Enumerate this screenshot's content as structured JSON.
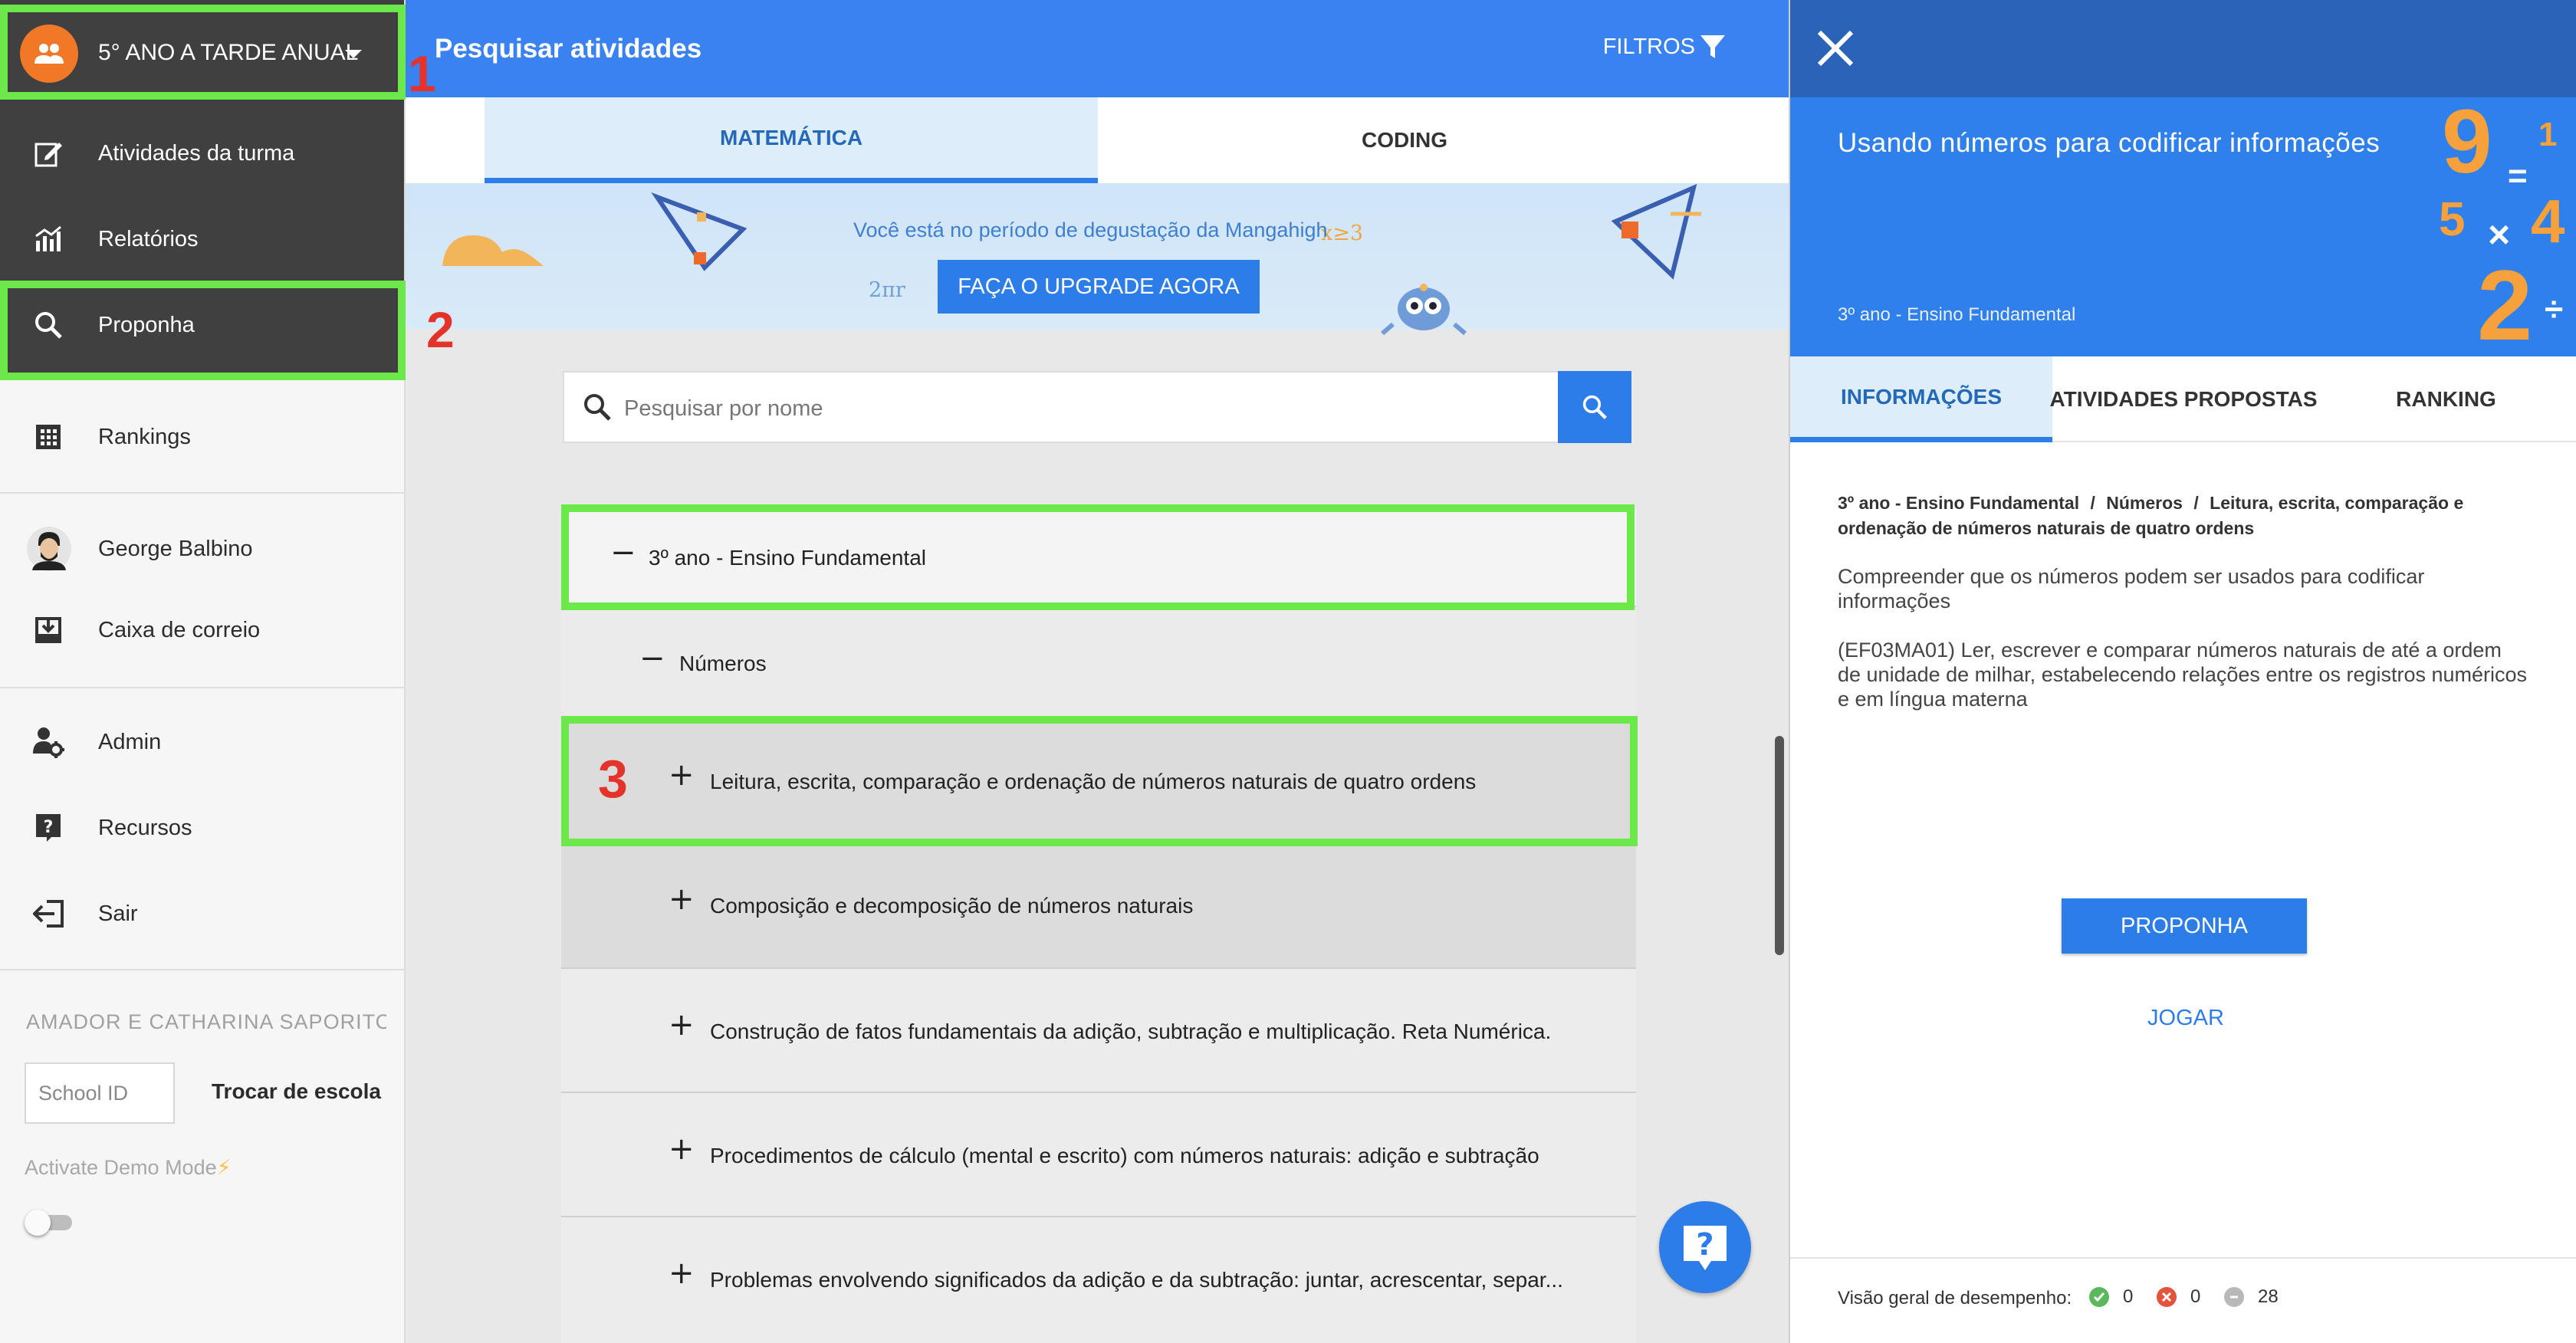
{
  "sidebar": {
    "class_selector": {
      "label": "5° ANO A TARDE ANUAL"
    },
    "items": [
      {
        "label": "Atividades da turma",
        "icon": "edit-icon"
      },
      {
        "label": "Relatórios",
        "icon": "bar-chart-icon"
      },
      {
        "label": "Proponha",
        "icon": "search-icon"
      },
      {
        "label": "Rankings",
        "icon": "grid-icon"
      },
      {
        "label": "George Balbino",
        "icon": "user-avatar"
      },
      {
        "label": "Caixa de correio",
        "icon": "inbox-icon"
      },
      {
        "label": "Admin",
        "icon": "admin-gear-icon"
      },
      {
        "label": "Recursos",
        "icon": "help-book-icon"
      },
      {
        "label": "Sair",
        "icon": "logout-icon"
      }
    ],
    "school_name": "AMADOR E CATHARINA SAPORITO ...",
    "school_id_placeholder": "School ID",
    "switch_school": "Trocar de escola",
    "demo_mode": "Activate Demo Mode",
    "demo_mode_on": false
  },
  "main": {
    "title": "Pesquisar atividades",
    "filters_label": "FILTROS",
    "tabs": [
      {
        "label": "MATEMÁTICA",
        "active": true
      },
      {
        "label": "CODING",
        "active": false
      }
    ],
    "banner": {
      "text": "Você está no período de degustação da Mangahigh",
      "button": "FAÇA O UPGRADE AGORA",
      "math_1": "2πr",
      "math_2": "x≥3"
    },
    "search": {
      "placeholder": "Pesquisar por nome"
    },
    "tree": [
      {
        "sign": "−",
        "label": "3º ano - Ensino Fundamental",
        "level": 0
      },
      {
        "sign": "−",
        "label": "Números",
        "level": 1
      },
      {
        "sign": "+",
        "label": "Leitura, escrita, comparação e ordenação de números naturais de quatro ordens",
        "level": 2
      },
      {
        "sign": "+",
        "label": "Composição e decomposição de números naturais",
        "level": 2
      },
      {
        "sign": "+",
        "label": "Construção de fatos fundamentais da adição, subtração e multiplicação. Reta Numérica.",
        "level": 2
      },
      {
        "sign": "+",
        "label": "Procedimentos de cálculo (mental e escrito) com números naturais: adição e subtração",
        "level": 2
      },
      {
        "sign": "+",
        "label": "Problemas envolvendo significados da adição e da subtração: juntar, acrescentar, separ...",
        "level": 2
      }
    ]
  },
  "annotations": {
    "step1": "1",
    "step2": "2",
    "step3": "3",
    "highlight_color": "#6de84a",
    "number_color": "#e4332b"
  },
  "panel": {
    "title": "Usando números para codificar informações",
    "grade": "3º ano - Ensino Fundamental",
    "deco": {
      "d1": "9",
      "d2": "1",
      "d3": "=",
      "d4": "5",
      "d5": "4",
      "d6": "×",
      "d7": "2",
      "d8": "÷"
    },
    "tabs": [
      {
        "label": "INFORMAÇÕES",
        "active": true
      },
      {
        "label": "ATIVIDADES PROPOSTAS",
        "active": false
      },
      {
        "label": "RANKING",
        "active": false
      }
    ],
    "breadcrumb": {
      "part1": "3º ano - Ensino Fundamental",
      "sep": "/",
      "part2": "Números",
      "part3": "Leitura, escrita, comparação e ordenação de números naturais de quatro ordens"
    },
    "description": "Compreender que os números podem ser usados para codificar informações",
    "standard": "(EF03MA01) Ler, escrever e comparar números naturais de até a ordem de unidade de milhar, estabelecendo relações entre os registros numéricos e em língua materna",
    "propose_button": "PROPONHA",
    "play_link": "JOGAR",
    "performance": {
      "label": "Visão geral de desempenho:",
      "correct": "0",
      "wrong": "0",
      "neutral": "28"
    }
  },
  "colors": {
    "primary": "#2d7de9",
    "header_blue": "#3b82f1",
    "sidebar_dark": "#404040",
    "avatar_orange": "#f07827",
    "panel_top": "#2b63b8"
  }
}
